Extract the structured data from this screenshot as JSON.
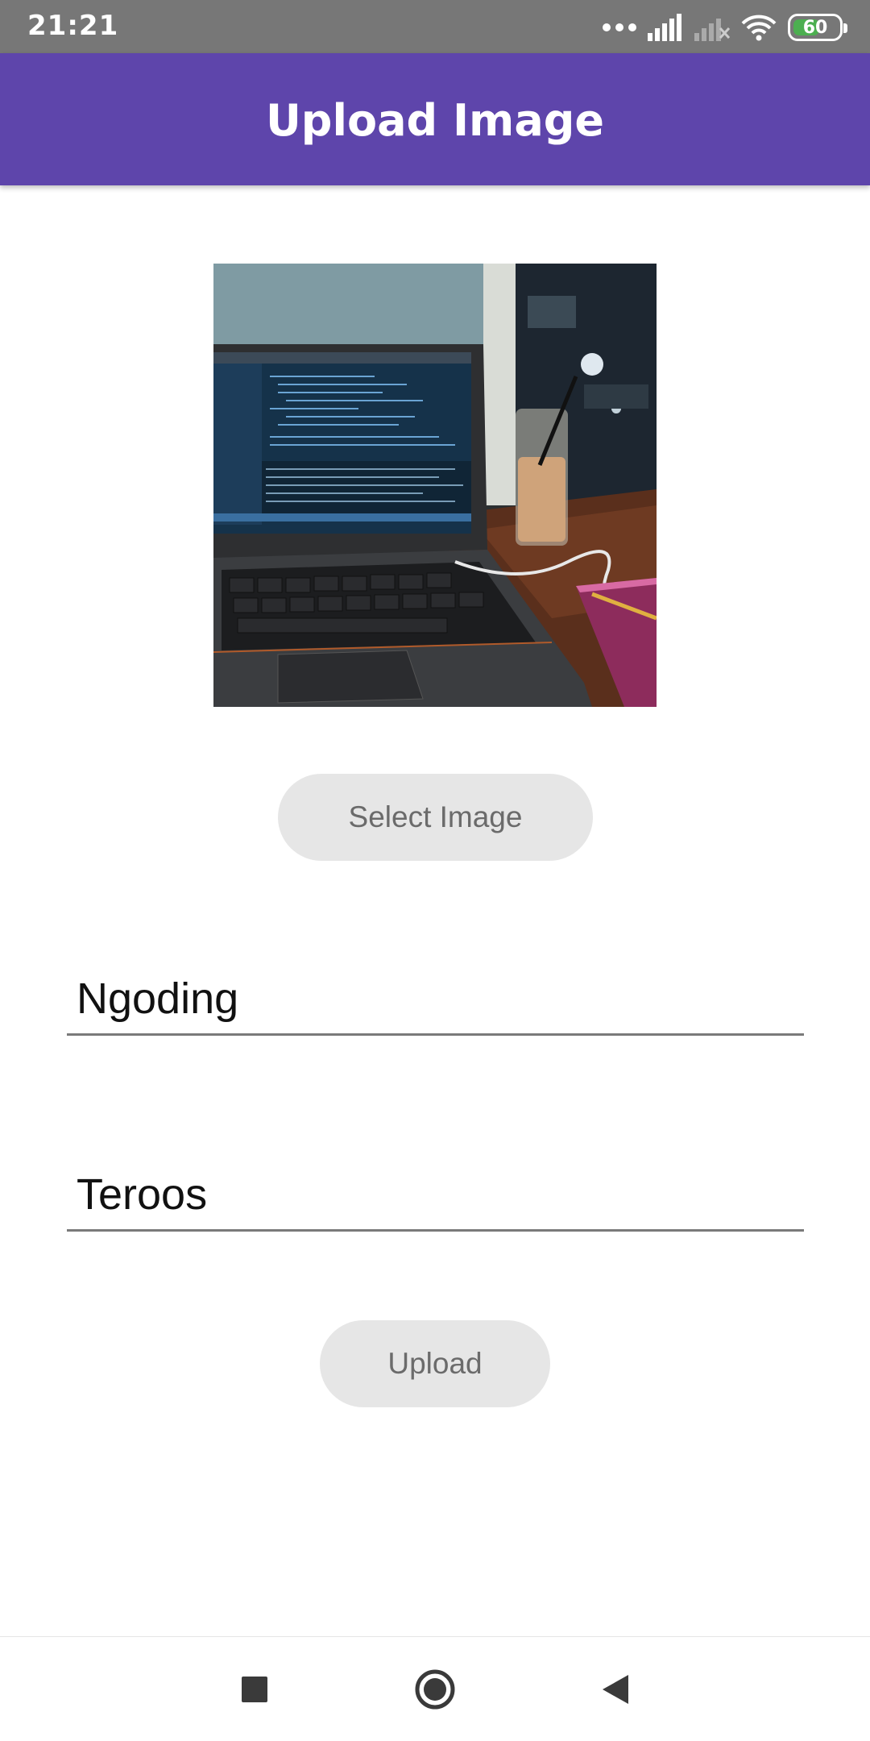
{
  "status_bar": {
    "time": "21:21",
    "battery_level": "60",
    "battery_color": "#4caf50",
    "icons": [
      "more-dots-icon",
      "signal-icon",
      "signal-off-icon",
      "wifi-icon",
      "battery-icon"
    ]
  },
  "app_bar": {
    "title": "Upload Image",
    "color": "#5e45ab"
  },
  "preview": {
    "description": "laptop-on-cafe-table-photo"
  },
  "buttons": {
    "select_image": "Select Image",
    "upload": "Upload"
  },
  "form": {
    "title_value": "Ngoding",
    "description_value": "Teroos"
  },
  "nav_bar": {
    "icons": [
      "recents-icon",
      "home-icon",
      "back-icon"
    ]
  }
}
